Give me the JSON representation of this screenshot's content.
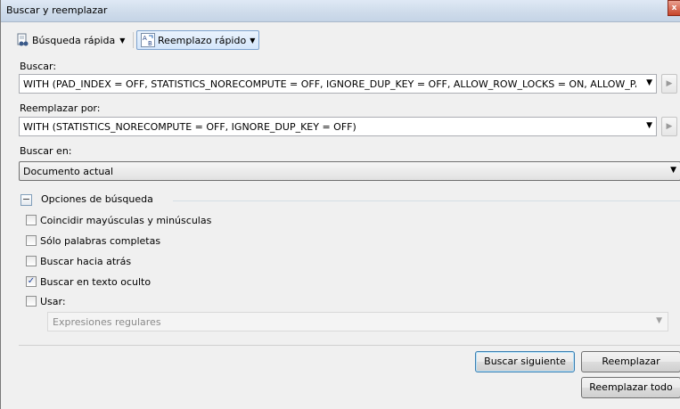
{
  "window": {
    "title": "Buscar y reemplazar"
  },
  "toolbar": {
    "quick_find_label": "Búsqueda rápida",
    "quick_replace_label": "Reemplazo rápido"
  },
  "find": {
    "label": "Buscar:",
    "value": "WITH (PAD_INDEX  = OFF, STATISTICS_NORECOMPUTE  = OFF, IGNORE_DUP_KEY = OFF, ALLOW_ROW_LOCKS  = ON, ALLOW_PA"
  },
  "replace": {
    "label": "Reemplazar por:",
    "value": "WITH (STATISTICS_NORECOMPUTE  = OFF, IGNORE_DUP_KEY = OFF)"
  },
  "look_in": {
    "label": "Buscar en:",
    "value": "Documento actual"
  },
  "options": {
    "title": "Opciones de búsqueda",
    "items": [
      {
        "label": "Coincidir mayúsculas y minúsculas",
        "checked": false
      },
      {
        "label": "Sólo palabras completas",
        "checked": false
      },
      {
        "label": "Buscar hacia atrás",
        "checked": false
      },
      {
        "label": "Buscar en texto oculto",
        "checked": true
      },
      {
        "label": "Usar:",
        "checked": false
      }
    ],
    "use_value": "Expresiones regulares"
  },
  "buttons": {
    "find_next": "Buscar siguiente",
    "replace": "Reemplazar",
    "replace_all": "Reemplazar todo"
  },
  "icons": {
    "close": "close-icon",
    "quick_find": "binoculars-document-icon",
    "quick_replace": "replace-ab-icon",
    "expand": "chevron-right-icon",
    "dropdown": "chevron-down-icon",
    "collapse": "minus-icon",
    "checkmark": "checkmark-icon"
  },
  "colors": {
    "accent": "#3c7fb1",
    "close": "#c7452b",
    "check": "#21459e"
  }
}
